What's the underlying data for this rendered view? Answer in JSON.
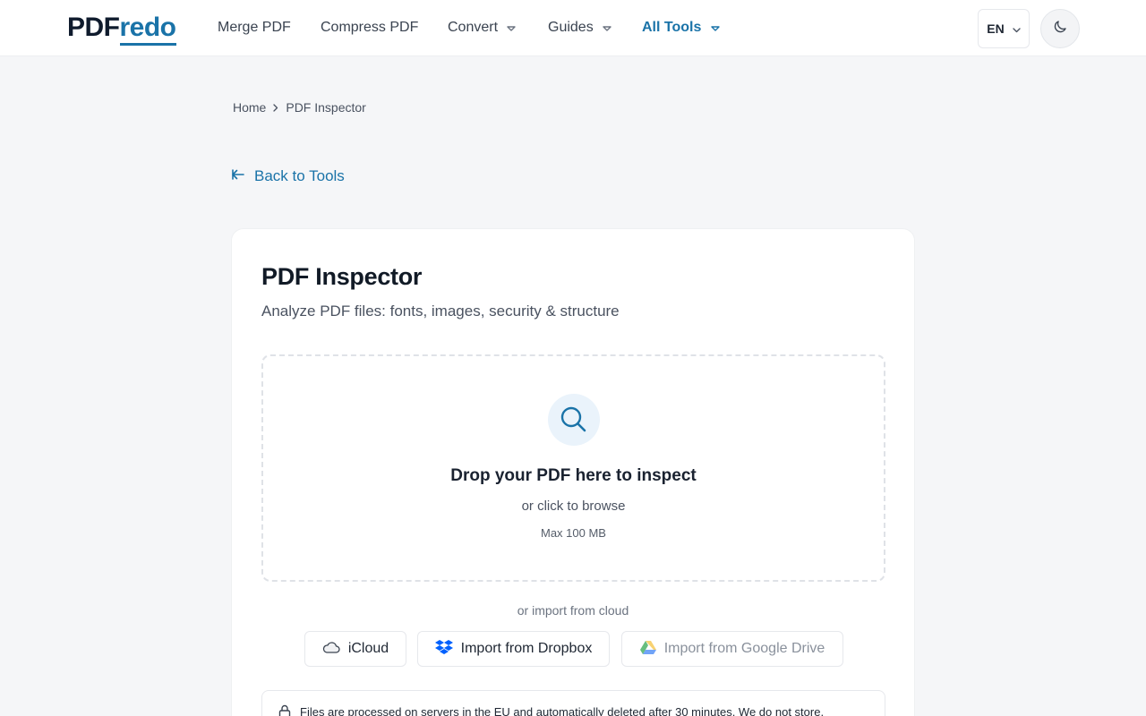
{
  "header": {
    "logo_part1": "PDF",
    "logo_part2": "redo",
    "nav": [
      {
        "label": "Merge PDF"
      },
      {
        "label": "Compress PDF"
      },
      {
        "label": "Convert"
      },
      {
        "label": "Guides"
      },
      {
        "label": "All Tools"
      }
    ],
    "language": "EN",
    "accent_color": "#1a73a8"
  },
  "breadcrumb": {
    "home": "Home",
    "current": "PDF Inspector"
  },
  "back_link": "Back to Tools",
  "tool": {
    "title": "PDF Inspector",
    "subtitle": "Analyze PDF files: fonts, images, security & structure",
    "dropzone": {
      "title": "Drop your PDF here to inspect",
      "browse": "or click to browse",
      "max_size": "Max 100 MB"
    },
    "cloud_label": "or import from cloud",
    "cloud_buttons": {
      "icloud": "iCloud",
      "dropbox": "Import from Dropbox",
      "gdrive": "Import from Google Drive"
    },
    "notice": "Files are processed on servers in the EU and automatically deleted after 30 minutes. We do not store,"
  }
}
